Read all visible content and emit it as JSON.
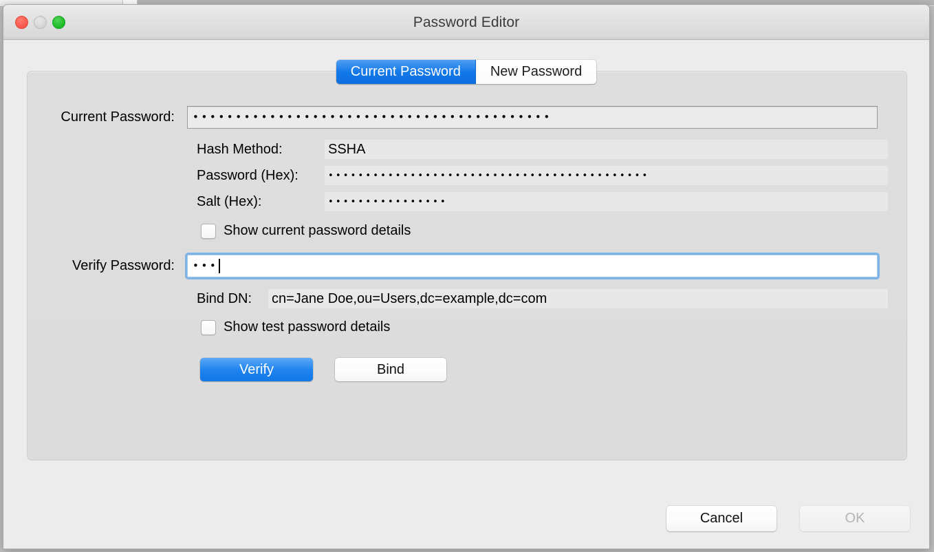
{
  "window": {
    "title": "Password Editor",
    "traffic_lights": [
      {
        "name": "close",
        "color": "#f9544a"
      },
      {
        "name": "minimize",
        "color": "#d3d3d3"
      },
      {
        "name": "maximize",
        "color": "#17bb24"
      }
    ]
  },
  "tabs": [
    {
      "label": "Current Password",
      "active": true
    },
    {
      "label": "New Password",
      "active": false
    }
  ],
  "form": {
    "current_password": {
      "label": "Current Password:",
      "value": "••••••••••••••••••••••••••••••••••••••••••",
      "masked": true,
      "char_count": 42
    },
    "hash_method": {
      "label": "Hash Method:",
      "value": "SSHA"
    },
    "password_hex": {
      "label": "Password (Hex):",
      "value": "•••••••••••••••••••••••••••••••••••••••••••",
      "masked": true,
      "char_count": 43
    },
    "salt_hex": {
      "label": "Salt (Hex):",
      "value": "••••••••••••••••",
      "masked": true,
      "char_count": 16
    },
    "show_current_details": {
      "label": "Show current password details",
      "checked": false
    },
    "verify_password": {
      "label": "Verify Password:",
      "value": "•••",
      "masked": true,
      "char_count": 3,
      "focused": true
    },
    "bind_dn": {
      "label": "Bind DN:",
      "value": "cn=Jane Doe,ou=Users,dc=example,dc=com"
    },
    "show_test_details": {
      "label": "Show test password details",
      "checked": false
    }
  },
  "actions": {
    "verify_label": "Verify",
    "bind_label": "Bind"
  },
  "footer": {
    "cancel_label": "Cancel",
    "ok_label": "OK",
    "ok_enabled": false
  },
  "colors": {
    "accent": "#1078e9",
    "window_bg": "#ececec",
    "panel_bg": "#dedede",
    "focus_ring": "#6dabe7"
  }
}
